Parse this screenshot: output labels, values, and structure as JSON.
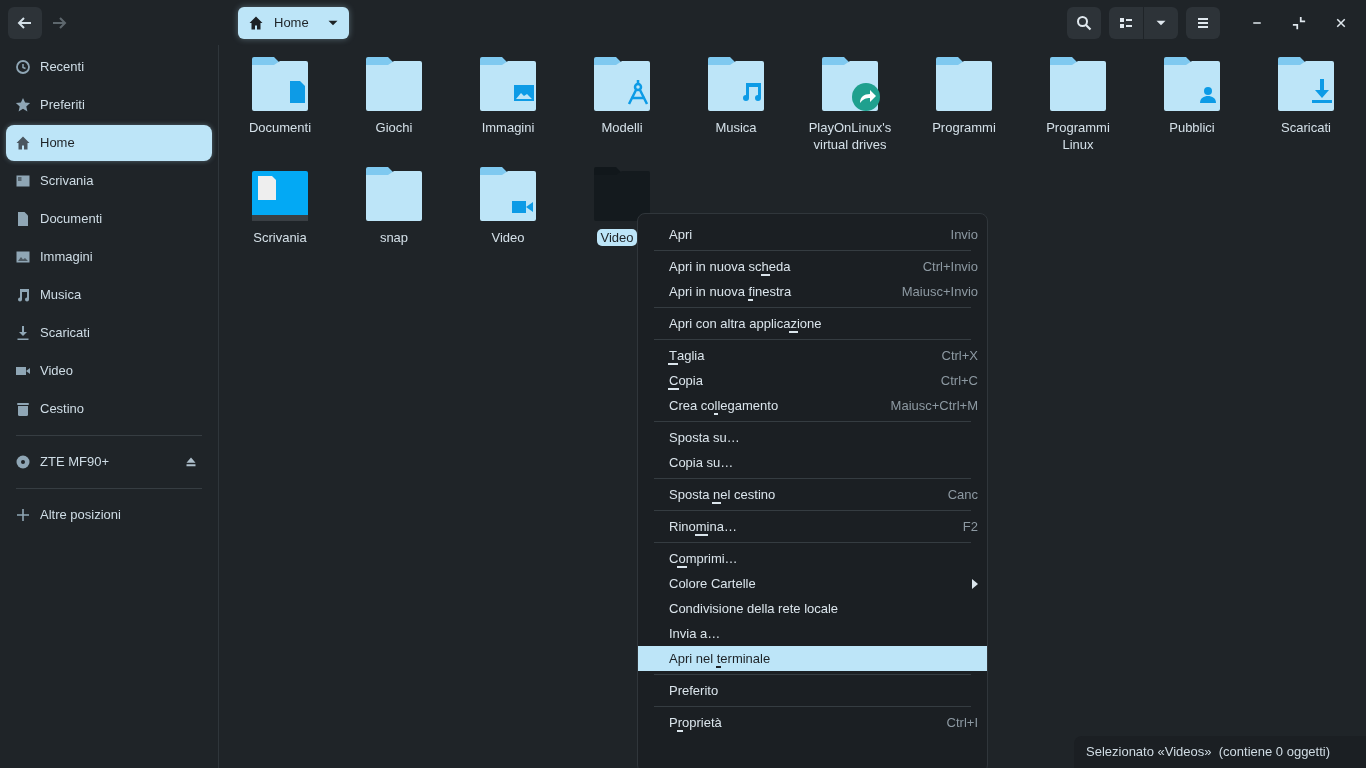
{
  "header": {
    "back_enabled": true,
    "forward_enabled": false,
    "path": "Home"
  },
  "sidebar": {
    "places": [
      {
        "label": "Recenti",
        "kind": "clock",
        "selected": false
      },
      {
        "label": "Preferiti",
        "kind": "star",
        "selected": false
      },
      {
        "label": "Home",
        "kind": "home",
        "selected": true
      },
      {
        "label": "Scrivania",
        "kind": "desktop",
        "selected": false
      },
      {
        "label": "Documenti",
        "kind": "document",
        "selected": false
      },
      {
        "label": "Immagini",
        "kind": "image",
        "selected": false
      },
      {
        "label": "Musica",
        "kind": "music",
        "selected": false
      },
      {
        "label": "Scaricati",
        "kind": "download",
        "selected": false
      },
      {
        "label": "Video",
        "kind": "video",
        "selected": false
      },
      {
        "label": "Cestino",
        "kind": "trash",
        "selected": false
      }
    ],
    "devices": [
      {
        "label": "ZTE MF90+",
        "kind": "disc",
        "selected": false,
        "ejectable": true
      }
    ],
    "other": [
      {
        "label": "Altre posizioni",
        "kind": "plus",
        "selected": false
      }
    ]
  },
  "files": [
    {
      "name": "Documenti",
      "kind": "document",
      "selected": false
    },
    {
      "name": "Giochi",
      "kind": "plain",
      "selected": false
    },
    {
      "name": "Immagini",
      "kind": "image",
      "selected": false
    },
    {
      "name": "Modelli",
      "kind": "template",
      "selected": false
    },
    {
      "name": "Musica",
      "kind": "music",
      "selected": false
    },
    {
      "name": "PlayOnLinux's virtual drives",
      "kind": "share",
      "selected": false
    },
    {
      "name": "Programmi",
      "kind": "plain",
      "selected": false
    },
    {
      "name": "Programmi Linux",
      "kind": "plain",
      "selected": false
    },
    {
      "name": "Pubblici",
      "kind": "user",
      "selected": false
    },
    {
      "name": "Scaricati",
      "kind": "download",
      "selected": false
    },
    {
      "name": "Scrivania",
      "kind": "desktop",
      "selected": false
    },
    {
      "name": "snap",
      "kind": "plain",
      "selected": false
    },
    {
      "name": "Video",
      "kind": "video",
      "selected": false
    },
    {
      "name": "Video",
      "kind": "plain",
      "selected": true
    }
  ],
  "context_menu": {
    "sections": [
      [
        {
          "label": [
            {
              "text": "Apri",
              "underlined": false
            }
          ],
          "shortcut": "Invio",
          "selected": false,
          "submenu": false
        }
      ],
      [
        {
          "label": [
            {
              "text": "Apri in nuova sc",
              "underlined": false
            },
            {
              "text": "h",
              "underlined": true
            },
            {
              "text": "eda",
              "underlined": false
            }
          ],
          "shortcut": "Ctrl+Invio",
          "selected": false,
          "submenu": false
        },
        {
          "label": [
            {
              "text": "Apri in nuova ",
              "underlined": false
            },
            {
              "text": "f",
              "underlined": true
            },
            {
              "text": "inestra",
              "underlined": false
            }
          ],
          "shortcut": "Maiusc+Invio",
          "selected": false,
          "submenu": false
        }
      ],
      [
        {
          "label": [
            {
              "text": "Apri con altra applica",
              "underlined": false
            },
            {
              "text": "z",
              "underlined": true
            },
            {
              "text": "ione",
              "underlined": false
            }
          ],
          "selected": false,
          "submenu": false
        }
      ],
      [
        {
          "label": [
            {
              "text": "T",
              "underlined": true
            },
            {
              "text": "aglia",
              "underlined": false
            }
          ],
          "shortcut": "Ctrl+X",
          "selected": false,
          "submenu": false
        },
        {
          "label": [
            {
              "text": "C",
              "underlined": true
            },
            {
              "text": "opia",
              "underlined": false
            }
          ],
          "shortcut": "Ctrl+C",
          "selected": false,
          "submenu": false
        },
        {
          "label": [
            {
              "text": "Crea co",
              "underlined": false
            },
            {
              "text": "l",
              "underlined": true
            },
            {
              "text": "legamento",
              "underlined": false
            }
          ],
          "shortcut": "Maiusc+Ctrl+M",
          "selected": false,
          "submenu": false
        }
      ],
      [
        {
          "label": [
            {
              "text": "Sposta su…",
              "underlined": false
            }
          ],
          "selected": false,
          "submenu": false
        },
        {
          "label": [
            {
              "text": "Copia su…",
              "underlined": false
            }
          ],
          "selected": false,
          "submenu": false
        }
      ],
      [
        {
          "label": [
            {
              "text": "Sposta ",
              "underlined": false
            },
            {
              "text": "n",
              "underlined": true
            },
            {
              "text": "el cestino",
              "underlined": false
            }
          ],
          "shortcut": "Canc",
          "selected": false,
          "submenu": false
        }
      ],
      [
        {
          "label": [
            {
              "text": "Rino",
              "underlined": false
            },
            {
              "text": "m",
              "underlined": true
            },
            {
              "text": "ina…",
              "underlined": false
            }
          ],
          "shortcut": "F2",
          "selected": false,
          "submenu": false
        }
      ],
      [
        {
          "label": [
            {
              "text": "C",
              "underlined": false
            },
            {
              "text": "o",
              "underlined": true
            },
            {
              "text": "mprimi…",
              "underlined": false
            }
          ],
          "selected": false,
          "submenu": false
        },
        {
          "label": [
            {
              "text": "Colore Cartelle",
              "underlined": false
            }
          ],
          "selected": false,
          "submenu": true
        },
        {
          "label": [
            {
              "text": "Condivisione della rete locale",
              "underlined": false
            }
          ],
          "selected": false,
          "submenu": false
        },
        {
          "label": [
            {
              "text": "Invia a…",
              "underlined": false
            }
          ],
          "selected": false,
          "submenu": false
        },
        {
          "label": [
            {
              "text": "Apri nel ",
              "underlined": false
            },
            {
              "text": "t",
              "underlined": true
            },
            {
              "text": "erminale",
              "underlined": false
            }
          ],
          "selected": true,
          "submenu": false
        }
      ],
      [
        {
          "label": [
            {
              "text": "Preferito",
              "underlined": false
            }
          ],
          "selected": false,
          "submenu": false
        }
      ],
      [
        {
          "label": [
            {
              "text": "P",
              "underlined": false
            },
            {
              "text": "r",
              "underlined": true
            },
            {
              "text": "oprietà",
              "underlined": false
            }
          ],
          "shortcut": "Ctrl+I",
          "selected": false,
          "submenu": false
        }
      ]
    ]
  },
  "status_bar": "Selezionato «Videos»  (contiene 0 oggetti)"
}
